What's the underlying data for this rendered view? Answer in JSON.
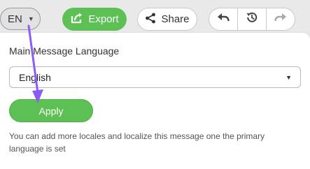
{
  "toolbar": {
    "language_button": "EN",
    "export_label": "Export",
    "share_label": "Share",
    "undo_icon": "undo-icon",
    "history_icon": "history-icon",
    "redo_icon": "redo-icon"
  },
  "panel": {
    "title": "Main Message Language",
    "selected_language": "English",
    "apply_label": "Apply",
    "help_text": "You can add more locales and localize this message one the primary language is set"
  },
  "colors": {
    "accent_green": "#5cc054",
    "annotation_purple": "#8b5cf6"
  }
}
